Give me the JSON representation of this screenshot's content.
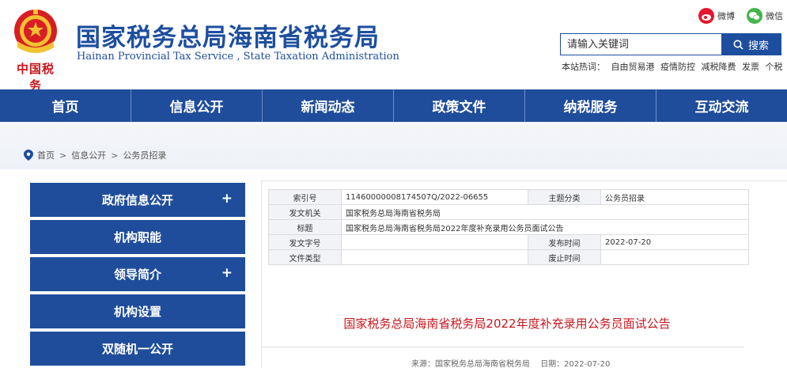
{
  "header": {
    "title_cn": "国家税务总局海南省税务局",
    "title_en": "Hainan Provincial Tax Service , State Taxation Administration",
    "emblem_caption": "中国税务",
    "social": [
      {
        "label": "微博",
        "icon": "weibo-icon",
        "color": "#e6162d"
      },
      {
        "label": "微信",
        "icon": "wechat-icon",
        "color": "#44b549"
      }
    ],
    "search": {
      "placeholder": "请输入关键词",
      "button_label": "搜索"
    },
    "hotwords_label": "本站热词：",
    "hotwords": [
      "自由贸易港",
      "疫情防控",
      "减税降费",
      "发票",
      "个税"
    ]
  },
  "nav": [
    "首页",
    "信息公开",
    "新闻动态",
    "政策文件",
    "纳税服务",
    "互动交流"
  ],
  "breadcrumb": [
    "首页",
    "信息公开",
    "公务员招录"
  ],
  "sidebar": [
    {
      "label": "政府信息公开",
      "expandable": true
    },
    {
      "label": "机构职能",
      "expandable": false
    },
    {
      "label": "领导简介",
      "expandable": true
    },
    {
      "label": "机构设置",
      "expandable": false
    },
    {
      "label": "双随机一公开",
      "expandable": false
    }
  ],
  "meta": {
    "index_label": "索引号",
    "index_value": "11460000008174507Q/2022-06655",
    "topic_label": "主题分类",
    "topic_value": "公务员招录",
    "issuer_label": "发文机关",
    "issuer_value": "国家税务总局海南省税务局",
    "title_label": "标题",
    "title_value": "国家税务总局海南省税务局2022年度补充录用公务员面试公告",
    "docno_label": "发文字号",
    "docno_value": "",
    "pubdate_label": "发布时间",
    "pubdate_value": "2022-07-20",
    "doctype_label": "文件类型",
    "doctype_value": "",
    "expire_label": "废止时间",
    "expire_value": ""
  },
  "article": {
    "title": "国家税务总局海南省税务局2022年度补充录用公务员面试公告",
    "source": "来源：国家税务总局海南省税务局",
    "date": "日期：2022-07-20"
  },
  "colors": {
    "brand_blue": "#1f4d9b",
    "accent_red": "#c8161d"
  }
}
